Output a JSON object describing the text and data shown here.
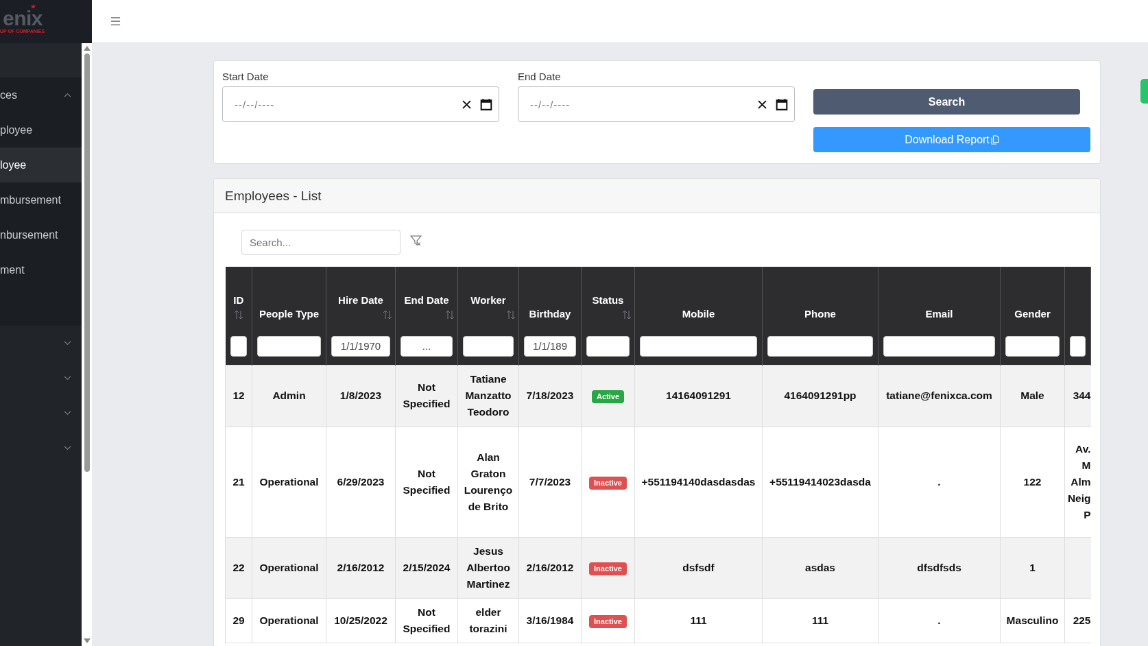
{
  "logo": {
    "name": "enix",
    "tagline": "UP OF COMPANIES"
  },
  "sidebar": {
    "items": [
      {
        "label": "ces",
        "expanded": true,
        "children": [
          {
            "label": "ployee",
            "selected": false
          },
          {
            "label": "loyee",
            "selected": true
          },
          {
            "label": "mbursement",
            "selected": false
          },
          {
            "label": "nbursement",
            "selected": false
          },
          {
            "label": "ment",
            "selected": false
          }
        ]
      },
      {
        "expanded": false
      },
      {
        "expanded": false
      },
      {
        "expanded": false
      },
      {
        "expanded": false
      }
    ]
  },
  "filters": {
    "start_date": {
      "label": "Start Date",
      "placeholder": "--/--/----"
    },
    "end_date": {
      "label": "End Date",
      "placeholder": "--/--/----"
    },
    "buttons": [
      {
        "kind": "search",
        "label": "Search"
      },
      {
        "kind": "download",
        "label": "Download Report"
      }
    ]
  },
  "employees": {
    "title": "Employees - List",
    "search": {
      "placeholder": "Search..."
    },
    "columns": [
      {
        "label": "ID",
        "sortable": true
      },
      {
        "label": "People Type",
        "sortable": false
      },
      {
        "label": "Hire Date",
        "sortable": true,
        "filter": "1/1/1970"
      },
      {
        "label": "End Date",
        "sortable": true,
        "filter": "..."
      },
      {
        "label": "Worker",
        "sortable": true
      },
      {
        "label": "Birthday",
        "sortable": false,
        "filter": "1/1/189"
      },
      {
        "label": "Status",
        "sortable": true
      },
      {
        "label": "Mobile",
        "sortable": false
      },
      {
        "label": "Phone",
        "sortable": false
      },
      {
        "label": "Email",
        "sortable": false
      },
      {
        "label": "Gender",
        "sortable": false
      },
      {
        "sortable": false
      }
    ],
    "rows": [
      {
        "cells": [
          "12",
          "Admin",
          "1/8/2023",
          "Not Specified",
          "Tatiane Manzatto Teodoro",
          "7/18/2023",
          {
            "status": "Active",
            "kind": "active"
          },
          "14164091291",
          "4164091291pp",
          "tatiane@fenixca.com",
          "Male",
          [
            "344"
          ]
        ]
      },
      {
        "cells": [
          "21",
          "Operational",
          "6/29/2023",
          "Not Specified",
          "Alan Graton Lourenço de Brito",
          "7/7/2023",
          {
            "status": "Inactive",
            "kind": "inactive"
          },
          "+551194140dasdasdas",
          "+55119414023dasda",
          ".",
          "122",
          [
            "Av.",
            "M",
            "Alm",
            "Neig",
            "P"
          ]
        ]
      },
      {
        "cells": [
          "22",
          "Operational",
          "2/16/2012",
          "2/15/2024",
          "Jesus Albertoo Martinez",
          "2/16/2012",
          {
            "status": "Inactive",
            "kind": "inactive"
          },
          "dsfsdf",
          "asdas",
          "dfsdfsds",
          "1",
          []
        ]
      },
      {
        "cells": [
          "29",
          "Operational",
          "10/25/2022",
          "Not Specified",
          "elder torazini",
          "3/16/1984",
          {
            "status": "Inactive",
            "kind": "inactive"
          },
          "111",
          "111",
          ".",
          "Masculino",
          [
            "225"
          ]
        ]
      }
    ]
  }
}
